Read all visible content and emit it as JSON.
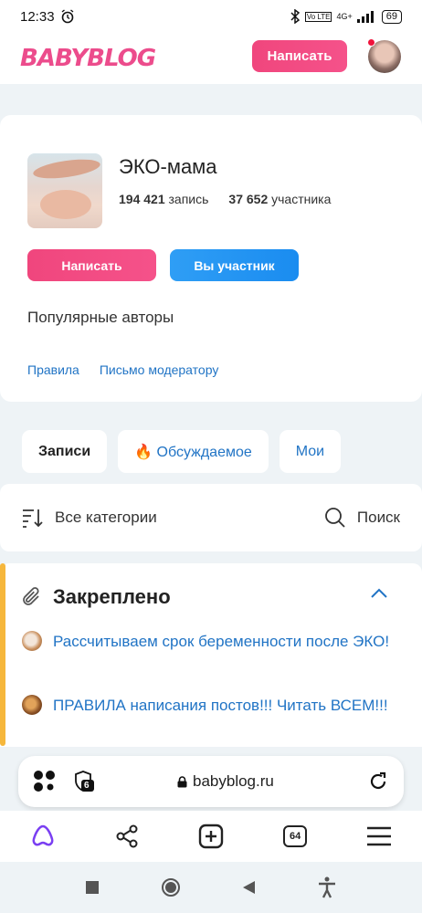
{
  "status_bar": {
    "time": "12:33",
    "network": "4G+",
    "volte": "Vo LTE",
    "battery": "69"
  },
  "header": {
    "logo": "BABYBLOG",
    "write_button": "Написать"
  },
  "community": {
    "title": "ЭКО-мама",
    "posts_count": "194 421",
    "posts_label": "запись",
    "members_count": "37 652",
    "members_label": "участника",
    "write_button": "Написать",
    "member_button": "Вы участник",
    "popular_authors": "Популярные авторы",
    "links": {
      "rules": "Правила",
      "moderator": "Письмо модератору"
    }
  },
  "tabs": [
    {
      "label": "Записи",
      "active": true
    },
    {
      "label": "🔥 Обсуждаемое",
      "active": false
    },
    {
      "label": "Мои",
      "active": false
    }
  ],
  "filter": {
    "categories": "Все категории",
    "search": "Поиск"
  },
  "pinned": {
    "title": "Закреплено",
    "items": [
      {
        "text": "Рассчитываем срок беременности после ЭКО!"
      },
      {
        "text": "ПРАВИЛА написания постов!!! Читать ВСЕМ!!!"
      }
    ]
  },
  "browser": {
    "url": "babyblog.ru",
    "shield_count": "6",
    "tabs_count": "64"
  },
  "colors": {
    "brand_pink": "#f0467d",
    "brand_blue": "#1a8cf0",
    "link": "#2174c5",
    "pinned_accent": "#f6b73c"
  }
}
